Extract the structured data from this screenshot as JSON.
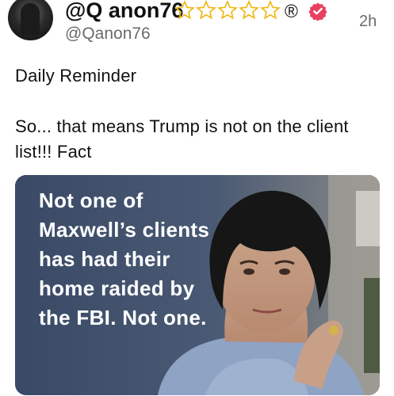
{
  "post": {
    "display_name": "@Q anon76",
    "handle": "@Qanon76",
    "timestamp": "2h",
    "badges": {
      "star_count": 5,
      "star_color": "#f0b91a",
      "registered_symbol": "®",
      "verified_icon": "verified-badge-icon",
      "verified_color": "#e8415f"
    },
    "text_line_1": "Daily Reminder",
    "text_line_2": "So... that means Trump is not on the client list!!! Fact",
    "media": {
      "overlay_text": "Not one of Maxwell’s clients has had their home raided by the FBI. Not one.",
      "background_color": "#3f4f6a"
    }
  }
}
